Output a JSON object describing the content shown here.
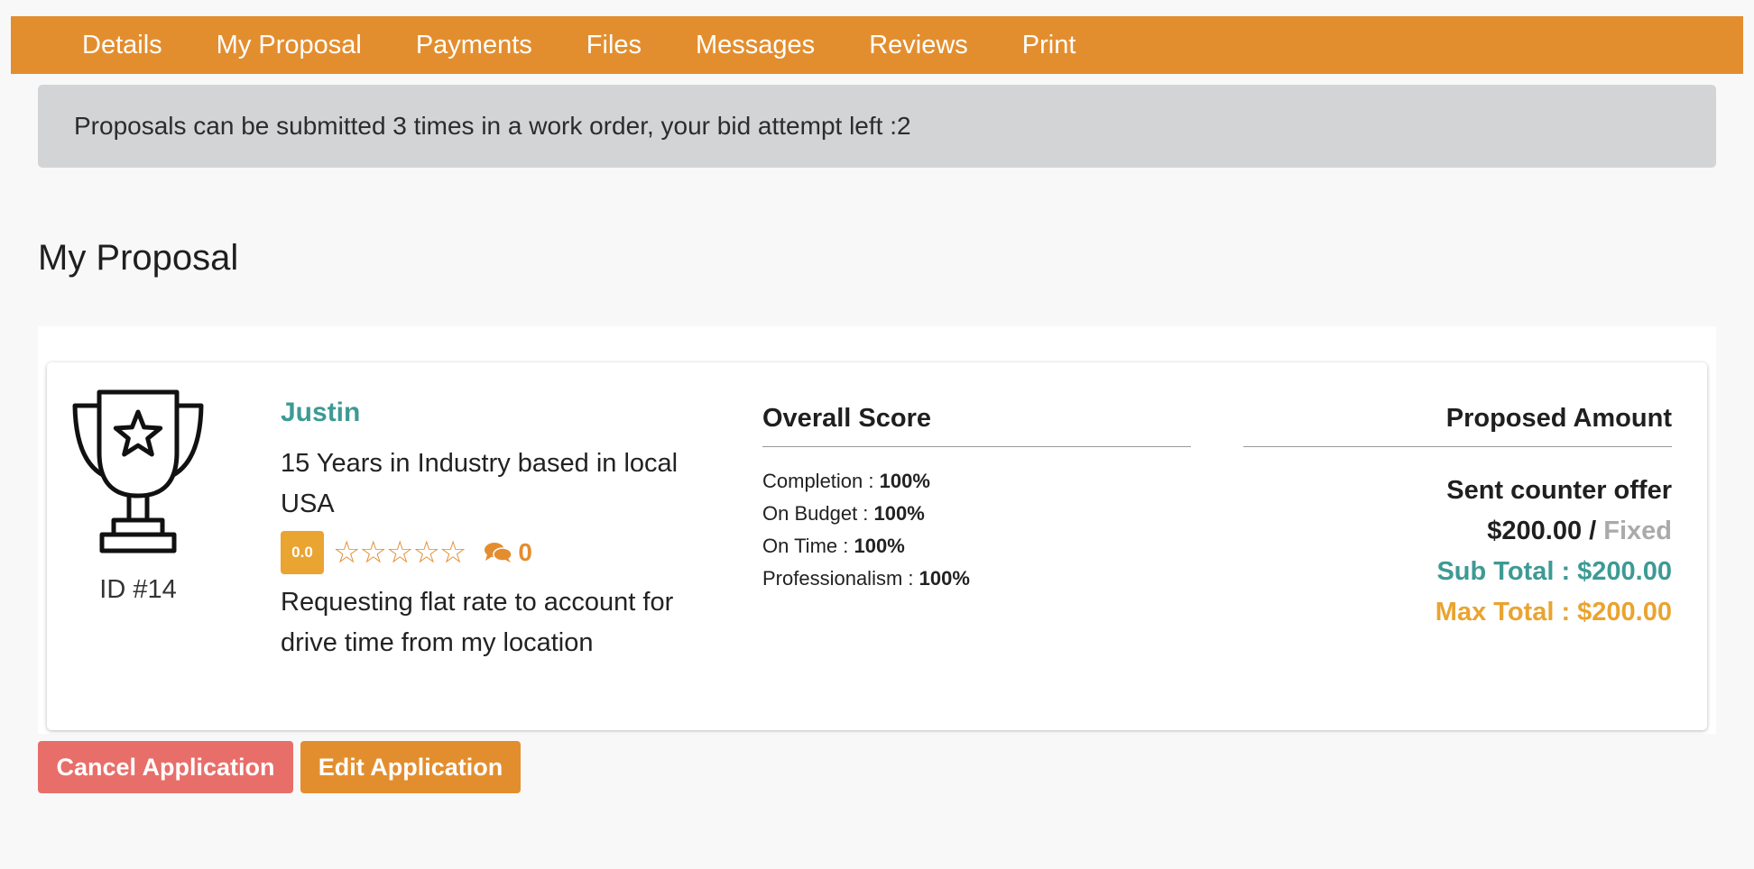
{
  "tabs": [
    {
      "label": "Details"
    },
    {
      "label": "My Proposal"
    },
    {
      "label": "Payments"
    },
    {
      "label": "Files"
    },
    {
      "label": "Messages"
    },
    {
      "label": "Reviews"
    },
    {
      "label": "Print"
    }
  ],
  "notice": {
    "text": "Proposals can be submitted 3 times in a work order, your bid attempt left :2"
  },
  "section_title": "My Proposal",
  "proposal": {
    "icon": "trophy-icon",
    "id_label": "ID #14",
    "name": "Justin",
    "bio": "15 Years in Industry based in local USA",
    "rating_value": "0.0",
    "stars": "☆☆☆☆☆",
    "stars_filled": 0,
    "comment_icon": "comments-icon",
    "comment_count": "0",
    "note": "Requesting flat rate to account for drive time from my location"
  },
  "score": {
    "heading": "Overall Score",
    "items": [
      {
        "label": "Completion : ",
        "value": "100%"
      },
      {
        "label": "On Budget : ",
        "value": "100%"
      },
      {
        "label": "On Time : ",
        "value": "100%"
      },
      {
        "label": "Professionalism : ",
        "value": "100%"
      }
    ]
  },
  "amount": {
    "heading": "Proposed Amount",
    "status": "Sent counter offer",
    "price": "$200.00",
    "separator": " / ",
    "price_type": "Fixed",
    "sub_total": "Sub Total : $200.00",
    "max_total": "Max Total : $200.00"
  },
  "buttons": {
    "cancel": "Cancel Application",
    "edit": "Edit Application"
  },
  "colors": {
    "brand_orange": "#e38e2e",
    "teal": "#3d9a94",
    "danger": "#e86e6a",
    "badge": "#e9a431"
  }
}
